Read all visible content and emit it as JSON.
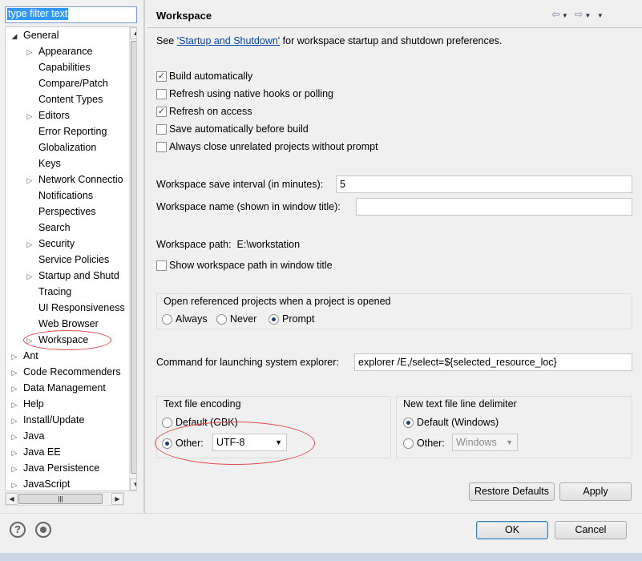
{
  "filter": {
    "value": "type filter text"
  },
  "tree": {
    "items": [
      {
        "label": "General",
        "toggle": "◢"
      },
      {
        "label": "Appearance",
        "toggle": "▷"
      },
      {
        "label": "Capabilities",
        "toggle": ""
      },
      {
        "label": "Compare/Patch",
        "toggle": ""
      },
      {
        "label": "Content Types",
        "toggle": ""
      },
      {
        "label": "Editors",
        "toggle": "▷"
      },
      {
        "label": "Error Reporting",
        "toggle": ""
      },
      {
        "label": "Globalization",
        "toggle": ""
      },
      {
        "label": "Keys",
        "toggle": ""
      },
      {
        "label": "Network Connectio",
        "toggle": "▷"
      },
      {
        "label": "Notifications",
        "toggle": ""
      },
      {
        "label": "Perspectives",
        "toggle": ""
      },
      {
        "label": "Search",
        "toggle": ""
      },
      {
        "label": "Security",
        "toggle": "▷"
      },
      {
        "label": "Service Policies",
        "toggle": ""
      },
      {
        "label": "Startup and Shutd",
        "toggle": "▷"
      },
      {
        "label": "Tracing",
        "toggle": ""
      },
      {
        "label": "UI Responsiveness",
        "toggle": ""
      },
      {
        "label": "Web Browser",
        "toggle": ""
      },
      {
        "label": "Workspace",
        "toggle": "▷"
      },
      {
        "label": "Ant",
        "toggle": "▷"
      },
      {
        "label": "Code Recommenders",
        "toggle": "▷"
      },
      {
        "label": "Data Management",
        "toggle": "▷"
      },
      {
        "label": "Help",
        "toggle": "▷"
      },
      {
        "label": "Install/Update",
        "toggle": "▷"
      },
      {
        "label": "Java",
        "toggle": "▷"
      },
      {
        "label": "Java EE",
        "toggle": "▷"
      },
      {
        "label": "Java Persistence",
        "toggle": "▷"
      },
      {
        "label": "JavaScript",
        "toggle": "▷"
      }
    ]
  },
  "page": {
    "title": "Workspace",
    "intro_prefix": "See ",
    "intro_link": "'Startup and Shutdown'",
    "intro_suffix": " for workspace startup and shutdown preferences.",
    "checkboxes": [
      {
        "label": "Build automatically",
        "checked": true
      },
      {
        "label": "Refresh using native hooks or polling",
        "checked": false
      },
      {
        "label": "Refresh on access",
        "checked": true
      },
      {
        "label": "Save automatically before build",
        "checked": false
      },
      {
        "label": "Always close unrelated projects without prompt",
        "checked": false
      }
    ],
    "save_interval_label": "Workspace save interval (in minutes):",
    "save_interval_value": "5",
    "ws_name_label": "Workspace name (shown in window title):",
    "ws_name_value": "",
    "ws_path_label": "Workspace path:",
    "ws_path_value": "E:\\workstation",
    "show_path_label": "Show workspace path in window title",
    "open_ref_group": {
      "title": "Open referenced projects when a project is opened",
      "options": [
        "Always",
        "Never",
        "Prompt"
      ],
      "selected": "Prompt"
    },
    "explorer_label": "Command for launching system explorer:",
    "explorer_value": "explorer /E,/select=${selected_resource_loc}",
    "encoding_group": {
      "title": "Text file encoding",
      "default_label": "Default (GBK)",
      "other_label": "Other:",
      "other_value": "UTF-8"
    },
    "delimiter_group": {
      "title": "New text file line delimiter",
      "default_label": "Default (Windows)",
      "other_label": "Other:",
      "other_value": "Windows"
    },
    "restore_defaults": "Restore Defaults",
    "apply": "Apply"
  },
  "dialog": {
    "ok": "OK",
    "cancel": "Cancel",
    "help_icon_glyph": "?"
  },
  "icons": {
    "accent": "#3399ff",
    "highlight_ellipse": "#e34b4b"
  }
}
